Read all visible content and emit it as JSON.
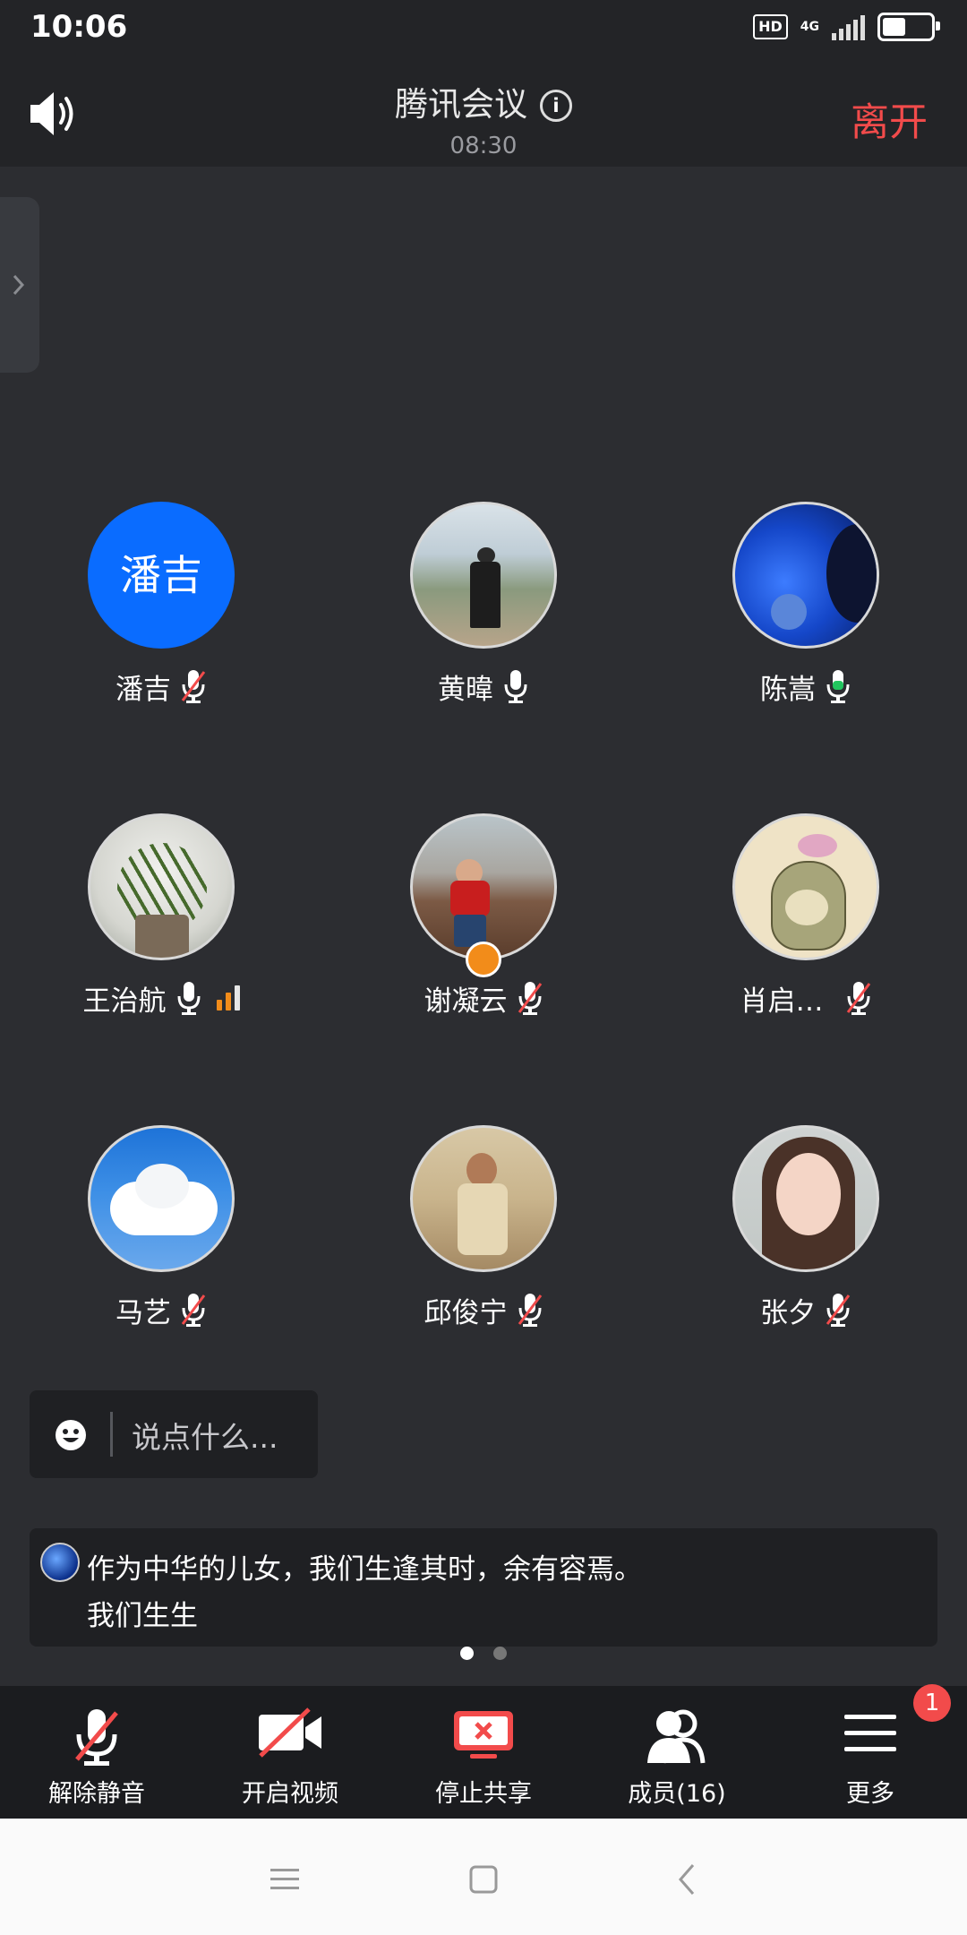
{
  "status_bar": {
    "time": "10:06",
    "hd": "HD",
    "network": "4G",
    "battery_level": 0.55
  },
  "header": {
    "title": "腾讯会议",
    "duration": "08:30",
    "leave_label": "离开",
    "leave_color": "#f24b4b"
  },
  "participants": [
    {
      "name": "潘吉",
      "avatar_text": "潘吉",
      "mic": "muted"
    },
    {
      "name": "黄暐",
      "mic": "on"
    },
    {
      "name": "陈嵩",
      "mic": "speaking"
    },
    {
      "name": "王治航",
      "mic": "on",
      "network_strength": 2
    },
    {
      "name": "谢凝云",
      "mic": "muted",
      "host": true
    },
    {
      "name": "肖启…",
      "mic": "muted"
    },
    {
      "name": "马艺",
      "mic": "muted"
    },
    {
      "name": "邱俊宁",
      "mic": "muted"
    },
    {
      "name": "张夕",
      "mic": "muted"
    }
  ],
  "chat": {
    "placeholder": "说点什么...",
    "message_line1": "作为中华的儿女，我们生逢其时，余有容焉。",
    "message_line2": "我们生生"
  },
  "pager": {
    "pages": 2,
    "current": 1
  },
  "toolbar": {
    "unmute_label": "解除静音",
    "video_label": "开启视频",
    "stop_share_label": "停止共享",
    "members_label": "成员(16)",
    "more_label": "更多",
    "more_badge": "1",
    "accent_red": "#f24b4b"
  }
}
